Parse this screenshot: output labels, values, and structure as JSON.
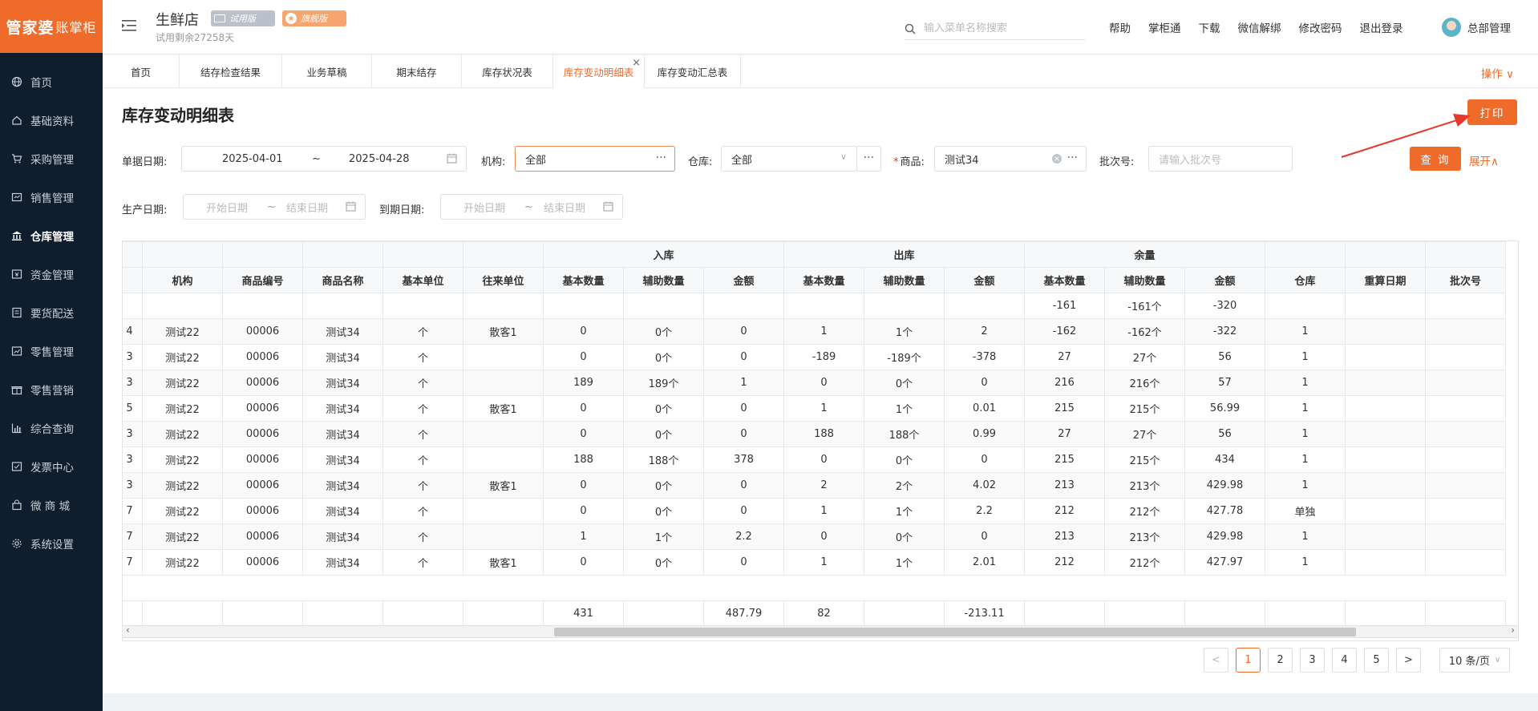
{
  "brand": {
    "logo_main": "管家婆",
    "logo_sub": "账掌柜"
  },
  "sidebar": {
    "items": [
      {
        "label": "首页",
        "icon": "globe-icon"
      },
      {
        "label": "基础资料",
        "icon": "home-icon"
      },
      {
        "label": "采购管理",
        "icon": "cart-icon"
      },
      {
        "label": "销售管理",
        "icon": "sales-icon"
      },
      {
        "label": "仓库管理",
        "icon": "bank-icon",
        "active": true
      },
      {
        "label": "资金管理",
        "icon": "wallet-icon"
      },
      {
        "label": "要货配送",
        "icon": "list-icon"
      },
      {
        "label": "零售管理",
        "icon": "chart-icon"
      },
      {
        "label": "零售营销",
        "icon": "gift-icon"
      },
      {
        "label": "综合查询",
        "icon": "bar-chart-icon"
      },
      {
        "label": "发票中心",
        "icon": "invoice-icon"
      },
      {
        "label": "微 商 城",
        "icon": "bag-icon"
      },
      {
        "label": "系统设置",
        "icon": "gear-icon"
      }
    ]
  },
  "header": {
    "store_name": "生鲜店",
    "badge_trial": "试用版",
    "badge_flag": "旗舰版",
    "trial_remaining": "试用剩余27258天",
    "search_placeholder": "输入菜单名称搜索",
    "links": [
      "帮助",
      "掌柜通",
      "下载",
      "微信解绑",
      "修改密码",
      "退出登录"
    ],
    "user_name": "总部管理"
  },
  "tabs": [
    {
      "label": "首页"
    },
    {
      "label": "结存检查结果"
    },
    {
      "label": "业务草稿"
    },
    {
      "label": "期末结存"
    },
    {
      "label": "库存状况表"
    },
    {
      "label": "库存变动明细表",
      "active": true
    },
    {
      "label": "库存变动汇总表"
    }
  ],
  "tabs_ops": "操作 ∨",
  "page": {
    "title": "库存变动明细表",
    "print_button": "打印",
    "query_button": "查 询",
    "expand_link": "展开∧"
  },
  "filters": {
    "date_label": "单据日期:",
    "date_start": "2025-04-01",
    "date_sep": "~",
    "date_end": "2025-04-28",
    "org_label": "机构:",
    "org_value": "全部",
    "warehouse_label": "仓库:",
    "warehouse_value": "全部",
    "product_label": "商品:",
    "product_required": "*",
    "product_value": "测试34",
    "batch_label": "批次号:",
    "batch_placeholder": "请输入批次号",
    "prod_date_label": "生产日期:",
    "prod_start_placeholder": "开始日期",
    "prod_end_placeholder": "结束日期",
    "expire_label": "到期日期:",
    "expire_start_placeholder": "开始日期",
    "expire_end_placeholder": "结束日期"
  },
  "table": {
    "group_headers": {
      "in": "入库",
      "out": "出库",
      "balance": "余量"
    },
    "columns": [
      "",
      "机构",
      "商品编号",
      "商品名称",
      "基本单位",
      "往来单位",
      "基本数量",
      "辅助数量",
      "金额",
      "基本数量",
      "辅助数量",
      "金额",
      "基本数量",
      "辅助数量",
      "金额",
      "仓库",
      "重算日期",
      "批次号"
    ],
    "opening_row": [
      "",
      "",
      "",
      "",
      "",
      "",
      "",
      "",
      "",
      "",
      "",
      "",
      "-161",
      "-161个",
      "-320",
      "",
      "",
      ""
    ],
    "rows": [
      [
        "4",
        "测试22",
        "00006",
        "测试34",
        "个",
        "散客1",
        "0",
        "0个",
        "0",
        "1",
        "1个",
        "2",
        "-162",
        "-162个",
        "-322",
        "1",
        "",
        ""
      ],
      [
        "3",
        "测试22",
        "00006",
        "测试34",
        "个",
        "",
        "0",
        "0个",
        "0",
        "-189",
        "-189个",
        "-378",
        "27",
        "27个",
        "56",
        "1",
        "",
        ""
      ],
      [
        "3",
        "测试22",
        "00006",
        "测试34",
        "个",
        "",
        "189",
        "189个",
        "1",
        "0",
        "0个",
        "0",
        "216",
        "216个",
        "57",
        "1",
        "",
        ""
      ],
      [
        "5",
        "测试22",
        "00006",
        "测试34",
        "个",
        "散客1",
        "0",
        "0个",
        "0",
        "1",
        "1个",
        "0.01",
        "215",
        "215个",
        "56.99",
        "1",
        "",
        ""
      ],
      [
        "3",
        "测试22",
        "00006",
        "测试34",
        "个",
        "",
        "0",
        "0个",
        "0",
        "188",
        "188个",
        "0.99",
        "27",
        "27个",
        "56",
        "1",
        "",
        ""
      ],
      [
        "3",
        "测试22",
        "00006",
        "测试34",
        "个",
        "",
        "188",
        "188个",
        "378",
        "0",
        "0个",
        "0",
        "215",
        "215个",
        "434",
        "1",
        "",
        ""
      ],
      [
        "3",
        "测试22",
        "00006",
        "测试34",
        "个",
        "散客1",
        "0",
        "0个",
        "0",
        "2",
        "2个",
        "4.02",
        "213",
        "213个",
        "429.98",
        "1",
        "",
        ""
      ],
      [
        "7",
        "测试22",
        "00006",
        "测试34",
        "个",
        "",
        "0",
        "0个",
        "0",
        "1",
        "1个",
        "2.2",
        "212",
        "212个",
        "427.78",
        "单独",
        "",
        ""
      ],
      [
        "7",
        "测试22",
        "00006",
        "测试34",
        "个",
        "",
        "1",
        "1个",
        "2.2",
        "0",
        "0个",
        "0",
        "213",
        "213个",
        "429.98",
        "1",
        "",
        ""
      ],
      [
        "7",
        "测试22",
        "00006",
        "测试34",
        "个",
        "散客1",
        "0",
        "0个",
        "0",
        "1",
        "1个",
        "2.01",
        "212",
        "212个",
        "427.97",
        "1",
        "",
        ""
      ]
    ],
    "totals": [
      "",
      "",
      "",
      "",
      "",
      "",
      "431",
      "",
      "487.79",
      "82",
      "",
      "-213.11",
      "",
      "",
      "",
      "",
      "",
      ""
    ]
  },
  "pagination": {
    "prev": "<",
    "pages": [
      "1",
      "2",
      "3",
      "4",
      "5"
    ],
    "current": "1",
    "next": ">",
    "page_size": "10 条/页"
  },
  "colors": {
    "accent": "#ee6b2a",
    "sidebar_bg": "#0f1d2d",
    "annotation_arrow": "#e8382a"
  }
}
